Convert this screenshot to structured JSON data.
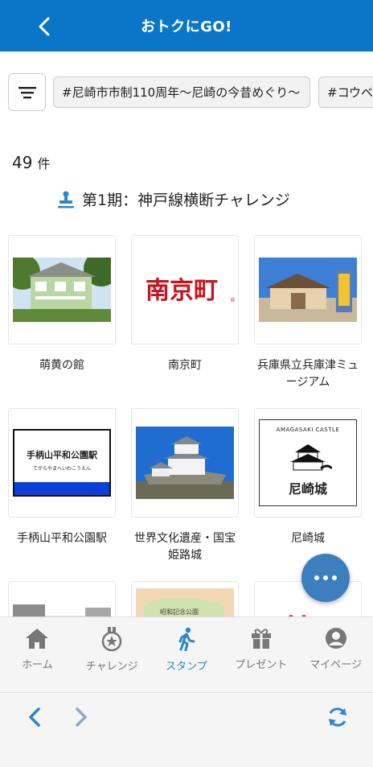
{
  "header": {
    "title": "おトクにGO!"
  },
  "tags": [
    {
      "label": "#尼崎市市制110周年〜尼崎の今昔めぐり〜"
    },
    {
      "label": "#コウベ"
    }
  ],
  "count": {
    "value": "49",
    "unit": "件"
  },
  "section": {
    "title": "第1期：神戸線横断チャレンジ"
  },
  "items": [
    {
      "name": "萌黄の館"
    },
    {
      "name": "南京町"
    },
    {
      "name": "兵庫県立兵庫津ミュージアム"
    },
    {
      "name": "手柄山平和公園駅"
    },
    {
      "name": "世界文化遺産・国宝姫路城"
    },
    {
      "name": "尼崎城"
    }
  ],
  "thumbs": {
    "nankinmachi_logo": "南京町",
    "station_sign_main": "手柄山平和公園駅",
    "station_sign_kana": "てがらやまへいわこうえん",
    "castle_arc": "AMAGASAKI CASTLE",
    "castle_name": "尼崎城",
    "partial_text": "昭和記念公園"
  },
  "bottom_nav": [
    {
      "label": "ホーム"
    },
    {
      "label": "チャレンジ"
    },
    {
      "label": "スタンプ"
    },
    {
      "label": "プレゼント"
    },
    {
      "label": "マイページ"
    }
  ],
  "colors": {
    "header": "#0b76c8",
    "accent": "#2a86cf",
    "fab": "#3b7fbf"
  }
}
